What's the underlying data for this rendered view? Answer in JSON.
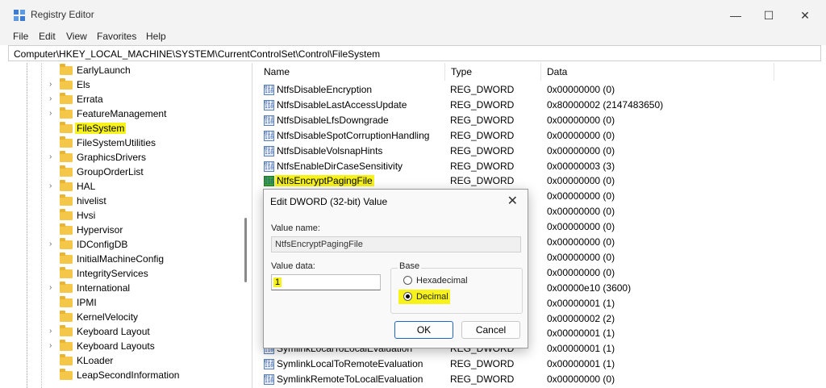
{
  "window": {
    "title": "Registry Editor",
    "minimize": "—",
    "maximize": "☐",
    "close": "✕"
  },
  "menu": [
    "File",
    "Edit",
    "View",
    "Favorites",
    "Help"
  ],
  "address": "Computer\\HKEY_LOCAL_MACHINE\\SYSTEM\\CurrentControlSet\\Control\\FileSystem",
  "tree": [
    {
      "label": "EarlyLaunch",
      "expandable": false
    },
    {
      "label": "Els",
      "expandable": true
    },
    {
      "label": "Errata",
      "expandable": true
    },
    {
      "label": "FeatureManagement",
      "expandable": true
    },
    {
      "label": "FileSystem",
      "expandable": false,
      "selected": true
    },
    {
      "label": "FileSystemUtilities",
      "expandable": false
    },
    {
      "label": "GraphicsDrivers",
      "expandable": true
    },
    {
      "label": "GroupOrderList",
      "expandable": false
    },
    {
      "label": "HAL",
      "expandable": true
    },
    {
      "label": "hivelist",
      "expandable": false
    },
    {
      "label": "Hvsi",
      "expandable": false
    },
    {
      "label": "Hypervisor",
      "expandable": false
    },
    {
      "label": "IDConfigDB",
      "expandable": true
    },
    {
      "label": "InitialMachineConfig",
      "expandable": false
    },
    {
      "label": "IntegrityServices",
      "expandable": false
    },
    {
      "label": "International",
      "expandable": true
    },
    {
      "label": "IPMI",
      "expandable": false
    },
    {
      "label": "KernelVelocity",
      "expandable": false
    },
    {
      "label": "Keyboard Layout",
      "expandable": true
    },
    {
      "label": "Keyboard Layouts",
      "expandable": true
    },
    {
      "label": "KLoader",
      "expandable": false
    },
    {
      "label": "LeapSecondInformation",
      "expandable": false
    }
  ],
  "columns": {
    "name": "Name",
    "type": "Type",
    "data": "Data"
  },
  "values": [
    {
      "name": "NtfsDisableEncryption",
      "type": "REG_DWORD",
      "data": "0x00000000 (0)"
    },
    {
      "name": "NtfsDisableLastAccessUpdate",
      "type": "REG_DWORD",
      "data": "0x80000002 (2147483650)"
    },
    {
      "name": "NtfsDisableLfsDowngrade",
      "type": "REG_DWORD",
      "data": "0x00000000 (0)"
    },
    {
      "name": "NtfsDisableSpotCorruptionHandling",
      "type": "REG_DWORD",
      "data": "0x00000000 (0)"
    },
    {
      "name": "NtfsDisableVolsnapHints",
      "type": "REG_DWORD",
      "data": "0x00000000 (0)"
    },
    {
      "name": "NtfsEnableDirCaseSensitivity",
      "type": "REG_DWORD",
      "data": "0x00000003 (3)"
    },
    {
      "name": "NtfsEncryptPagingFile",
      "type": "REG_DWORD",
      "data": "0x00000000 (0)",
      "selected": true
    },
    {
      "name": "",
      "type": "",
      "data": "0x00000000 (0)"
    },
    {
      "name": "",
      "type": "",
      "data": "0x00000000 (0)"
    },
    {
      "name": "",
      "type": "",
      "data": "0x00000000 (0)"
    },
    {
      "name": "",
      "type": "",
      "data": "0x00000000 (0)"
    },
    {
      "name": "",
      "type": "",
      "data": "0x00000000 (0)"
    },
    {
      "name": "",
      "type": "",
      "data": "0x00000000 (0)"
    },
    {
      "name": "",
      "type": "",
      "data": "0x00000e10 (3600)"
    },
    {
      "name": "",
      "type": "",
      "data": "0x00000001 (1)"
    },
    {
      "name": "",
      "type": "",
      "data": "0x00000002 (2)"
    },
    {
      "name": "",
      "type": "",
      "data": "0x00000001 (1)"
    },
    {
      "name": "SymlinkLocalToLocalEvaluation",
      "type": "REG_DWORD",
      "data": "0x00000001 (1)"
    },
    {
      "name": "SymlinkLocalToRemoteEvaluation",
      "type": "REG_DWORD",
      "data": "0x00000001 (1)"
    },
    {
      "name": "SymlinkRemoteToLocalEvaluation",
      "type": "REG_DWORD",
      "data": "0x00000000 (0)"
    }
  ],
  "dialog": {
    "title": "Edit DWORD (32-bit) Value",
    "close": "✕",
    "value_name_label": "Value name:",
    "value_name": "NtfsEncryptPagingFile",
    "value_data_label": "Value data:",
    "value_data": "1",
    "base_label": "Base",
    "hex_label": "Hexadecimal",
    "dec_label": "Decimal",
    "base_selected": "Decimal",
    "ok": "OK",
    "cancel": "Cancel"
  },
  "colors": {
    "highlight": "#f7f21a",
    "accent": "#1a66c9",
    "folder": "#f5c748"
  }
}
